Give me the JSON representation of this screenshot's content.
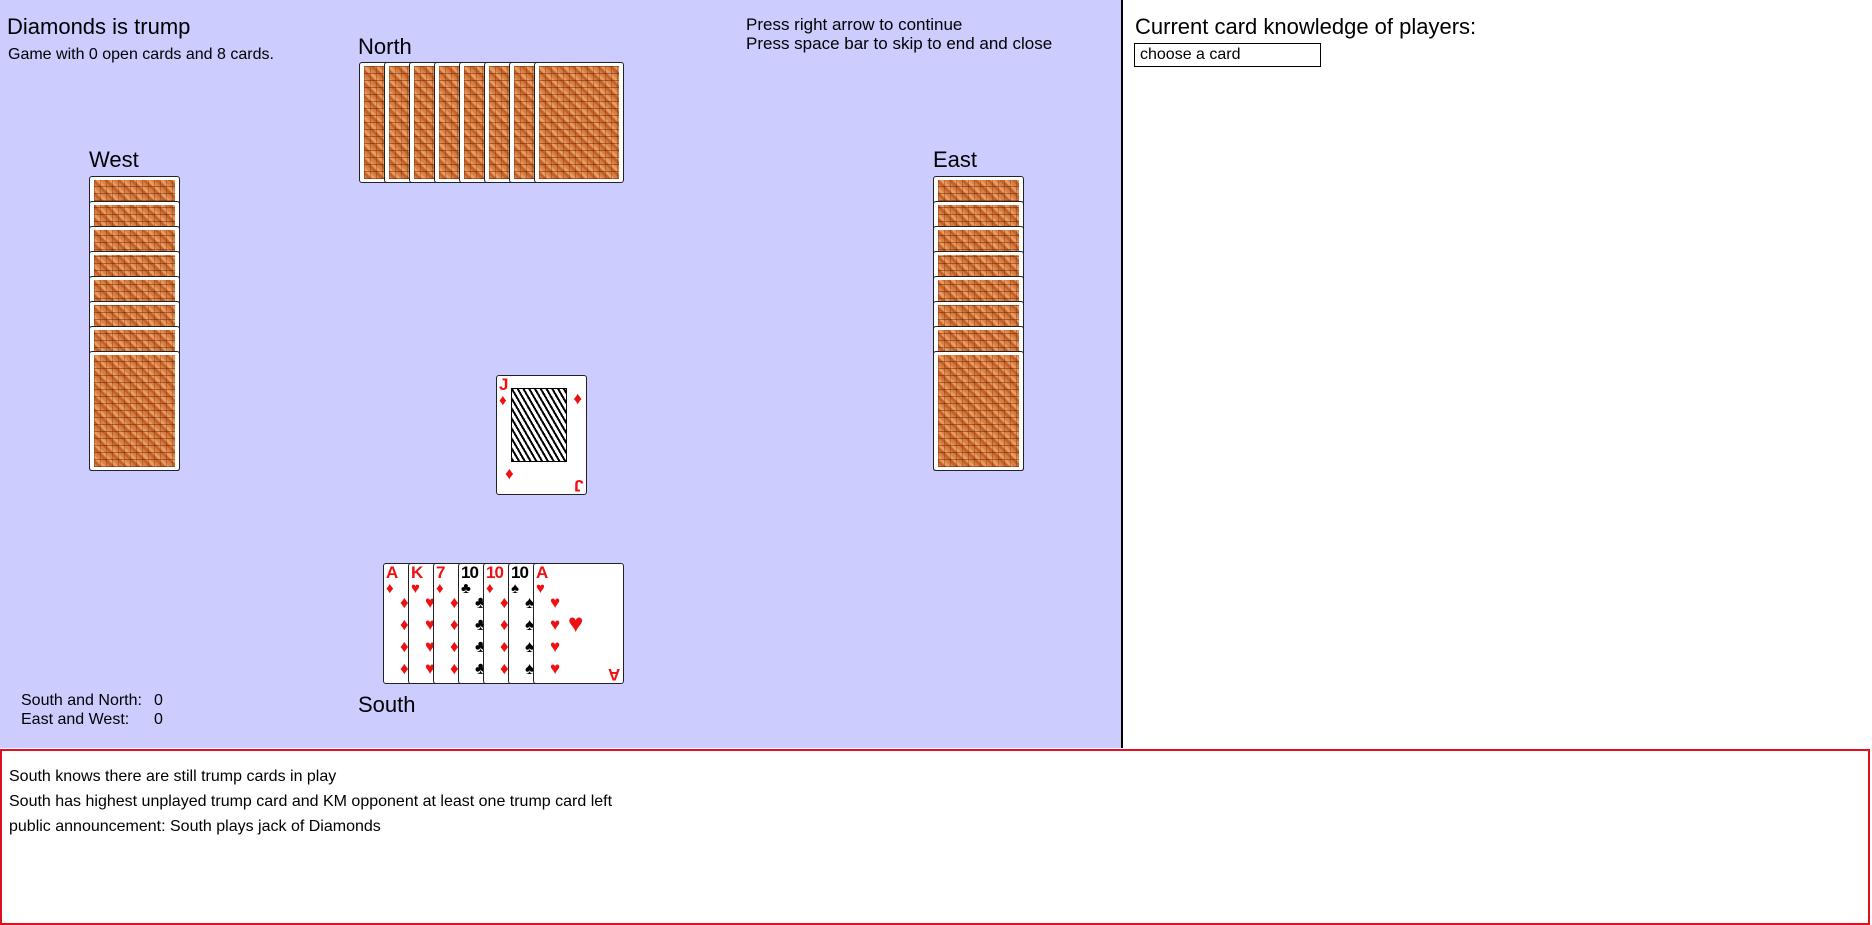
{
  "table": {
    "trump_title": "Diamonds is trump",
    "game_info": "Game with 0 open cards and 8 cards.",
    "hint_continue": "Press right arrow to continue",
    "hint_skip": "Press space bar to skip to end and close",
    "players": {
      "north": "North",
      "west": "West",
      "east": "East",
      "south": "South"
    },
    "score": {
      "south_north_label": "South and North:",
      "south_north_value": "0",
      "east_west_label": "East and West:",
      "east_west_value": "0"
    },
    "played_card": {
      "rank": "J",
      "suit": "♦",
      "suit_name": "diamonds"
    },
    "south_hand": [
      {
        "rank": "A",
        "suit": "♦"
      },
      {
        "rank": "K",
        "suit": "♥"
      },
      {
        "rank": "7",
        "suit": "♦"
      },
      {
        "rank": "10",
        "suit": "♣"
      },
      {
        "rank": "10",
        "suit": "♦"
      },
      {
        "rank": "10",
        "suit": "♠"
      },
      {
        "rank": "A",
        "suit": "♥"
      }
    ],
    "hidden_card_counts": {
      "north": 8,
      "west": 8,
      "east": 8
    }
  },
  "knowledge": {
    "title": "Current card knowledge of players:",
    "select_value": "choose a card"
  },
  "log": [
    "South knows there are still trump cards in play",
    "South has highest unplayed trump card and KM opponent at least one trump card left",
    "public announcement: South plays jack of Diamonds"
  ],
  "colors": {
    "table_bg": "#ccccff",
    "log_border": "#e0101e",
    "red_suit": "#ee1111",
    "card_back": "#d87f44"
  }
}
